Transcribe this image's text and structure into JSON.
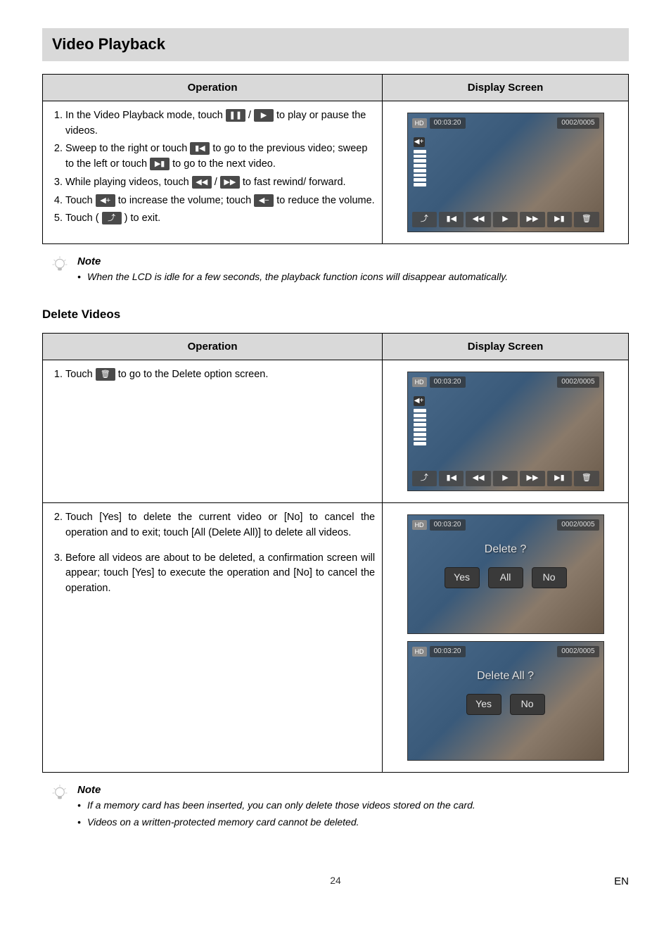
{
  "title": "Video Playback",
  "table1": {
    "col_op": "Operation",
    "col_disp": "Display Screen",
    "step1a": "In the Video Playback mode, touch ",
    "step1b": " to play or pause the videos.",
    "step2a": "Sweep to the right or touch ",
    "step2b": " to go to the previous video; sweep to the left or touch ",
    "step2c": " to go to the next video.",
    "step3a": "While playing videos, touch ",
    "step3b": " to fast rewind/ forward.",
    "step4a": "Touch ",
    "step4b": " to increase the volume; touch ",
    "step4c": " to reduce the volume.",
    "step5a": "Touch ( ",
    "step5b": " ) to exit."
  },
  "icons": {
    "pause": "❚❚",
    "play": "▶",
    "prev": "▮◀",
    "next": "▶▮",
    "rew": "◀◀",
    "ff": "▶▶",
    "volup": "◀+",
    "voldn": "◀−",
    "back": "⤴",
    "trash": "🗑"
  },
  "screen": {
    "hd": "HD",
    "time": "00:03:20",
    "count": "0002/0005",
    "segplus": "◀+"
  },
  "note1": {
    "title": "Note",
    "item1": "When the LCD is idle for a few seconds, the playback function icons will disappear automatically."
  },
  "subheading": "Delete Videos",
  "table2": {
    "col_op": "Operation",
    "col_disp": "Display Screen",
    "step1a": "Touch ",
    "step1b": " to go to the Delete option screen.",
    "step2": "Touch [Yes] to delete the current video or [No] to cancel the operation and to exit; touch [All (Delete All)] to delete all videos.",
    "step3": "Before all videos are about to be deleted, a confirmation screen will appear; touch [Yes] to execute the operation and [No] to cancel the operation."
  },
  "dialog1": {
    "text": "Delete ?",
    "yes": "Yes",
    "all": "All",
    "no": "No"
  },
  "dialog2": {
    "text": "Delete All ?",
    "yes": "Yes",
    "no": "No"
  },
  "note2": {
    "title": "Note",
    "item1": "If a memory card has been inserted, you can only delete those videos stored on the card.",
    "item2": "Videos on a written-protected memory card cannot be deleted."
  },
  "footer": {
    "page": "24",
    "lang": "EN"
  }
}
